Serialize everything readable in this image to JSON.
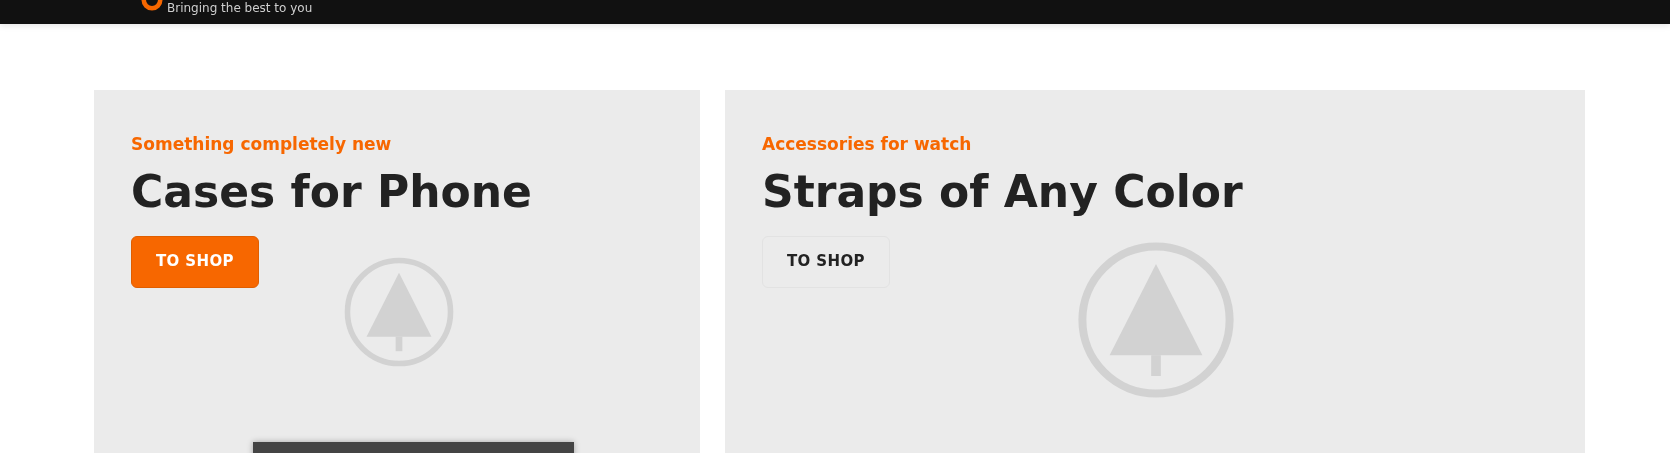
{
  "header": {
    "tagline": "Bringing the best to you"
  },
  "banners": [
    {
      "eyebrow": "Something completely new",
      "title": "Cases for Phone",
      "button": {
        "label": "TO SHOP",
        "kind": "primary"
      }
    },
    {
      "eyebrow": "Accessories for watch",
      "title": "Straps of Any Color",
      "button": {
        "label": "TO SHOP",
        "kind": "outline"
      }
    }
  ]
}
